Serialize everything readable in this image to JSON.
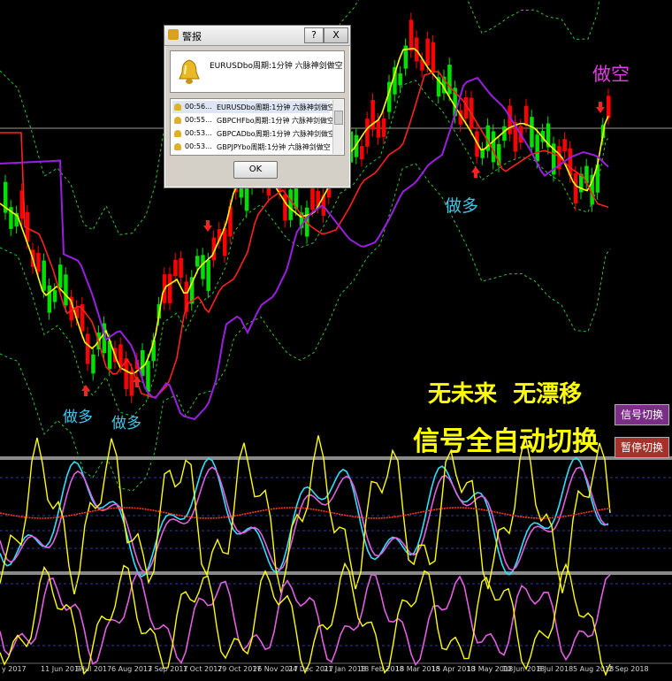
{
  "price_chart": {
    "signals": [
      {
        "label": "做多",
        "color": "#3fc6e8"
      },
      {
        "label": "做多",
        "color": "#3fc6e8"
      },
      {
        "label": "做多",
        "color": "#3fc6e8"
      },
      {
        "label": "做空",
        "color": "#e040e0"
      }
    ],
    "slogan_line1": "无未来  无漂移",
    "slogan_line2": "信号全自动切换",
    "slogan_color": "#ffff00"
  },
  "alert_window": {
    "title": "警报",
    "help_label": "?",
    "close_label": "X",
    "message": "EURUSDbo周期:1分钟 六脉神剑做空",
    "rows": [
      {
        "time": "00:56...",
        "text": "EURUSDbo周期:1分钟 六脉神剑做空"
      },
      {
        "time": "00:55...",
        "text": "GBPCHFbo周期:1分钟 六脉神剑做空"
      },
      {
        "time": "00:53...",
        "text": "GBPCADbo周期:1分钟 六脉神剑做空"
      },
      {
        "time": "00:53...",
        "text": "GBPJPYbo周期:1分钟 六脉神剑做空"
      }
    ],
    "ok_label": "OK"
  },
  "buttons": {
    "signal_switch": "信号切换",
    "pause_switch": "暂停切换"
  },
  "x_axis": {
    "labels": [
      "y 2017",
      "11 Jun 2017",
      "9 Jul 2017",
      "6 Aug 2017",
      "3 Sep 2017",
      "1 Oct 2017",
      "29 Oct 2017",
      "26 Nov 2017",
      "24 Dec 2017",
      "21 Jan 2018",
      "18 Feb 2018",
      "18 Mar 2018",
      "15 Apr 2018",
      "13 May 2018",
      "10 Jun 2018",
      "8 Jul 2018",
      "5 Aug 2018",
      "2 Sep 2018"
    ]
  },
  "colors": {
    "bull": "#ff0000",
    "bear": "#00e000",
    "fast_ma": "#ffff00",
    "mid_ma": "#ff2020",
    "slow_ma": "#9a1fe0",
    "envelope": "#33c033",
    "osc_cyan": "#30e0ff",
    "osc_magenta": "#e060e0"
  }
}
